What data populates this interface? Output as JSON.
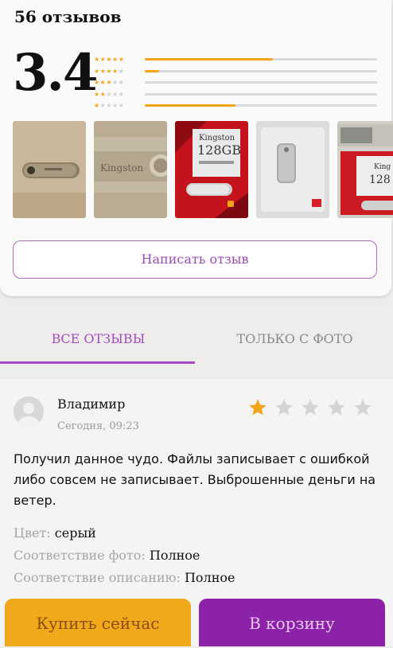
{
  "summary": {
    "count_label": "56 отзывов",
    "average": "3.4",
    "distribution": [
      {
        "stars": 5,
        "fraction": 0.55
      },
      {
        "stars": 4,
        "fraction": 0.06
      },
      {
        "stars": 3,
        "fraction": 0.0
      },
      {
        "stars": 2,
        "fraction": 0.0
      },
      {
        "stars": 1,
        "fraction": 0.39
      }
    ],
    "photo_labels": {
      "photo2": "Kingston",
      "photo3_brand": "Kingston",
      "photo3_size": "128GB",
      "photo5_brand": "King",
      "photo5_size": "128"
    },
    "write_button": "Написать отзыв"
  },
  "tabs": {
    "all": "ВСЕ ОТЗЫВЫ",
    "photo_only": "ТОЛЬКО С ФОТО"
  },
  "review": {
    "author": "Владимир",
    "date": "Сегодня, 09:23",
    "rating": 1,
    "max_rating": 5,
    "text": "Получил данное чудо. Файлы записывает с ошибкой либо совсем не записывает. Выброшенные деньги на ветер.",
    "props": [
      {
        "key": "Цвет:",
        "value": "серый"
      },
      {
        "key": "Соответствие фото:",
        "value": "Полное"
      },
      {
        "key": "Соответствие описанию:",
        "value": "Полное"
      }
    ]
  },
  "actions": {
    "buy_now": "Купить сейчас",
    "to_cart": "В корзину"
  },
  "colors": {
    "accent": "#a44bc3",
    "star": "#f3a51a",
    "buy": "#f1a91c",
    "cart": "#8b22a8"
  }
}
